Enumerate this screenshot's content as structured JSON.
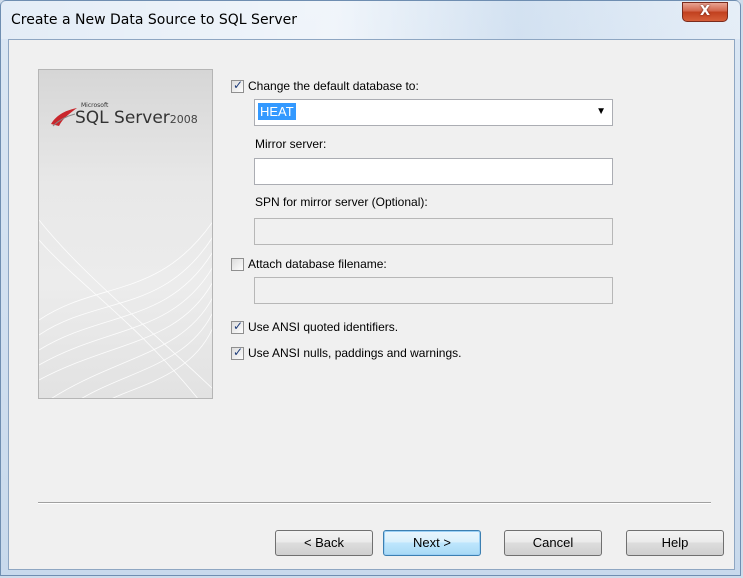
{
  "window": {
    "title": "Create a New Data Source to SQL Server",
    "close_label": "X"
  },
  "banner": {
    "logo_company": "Microsoft",
    "logo_product": "SQL Server",
    "logo_year": "2008"
  },
  "options": {
    "change_default_db": {
      "label": "Change the default database to:",
      "checked": true
    },
    "default_db_value": "HEAT",
    "mirror_server": {
      "label": "Mirror server:",
      "value": ""
    },
    "spn_mirror": {
      "label": "SPN for mirror server (Optional):",
      "value": ""
    },
    "attach_db": {
      "label": "Attach database filename:",
      "checked": false,
      "value": ""
    },
    "ansi_quoted": {
      "label": "Use ANSI quoted identifiers.",
      "checked": true
    },
    "ansi_nulls": {
      "label": "Use ANSI nulls, paddings and warnings.",
      "checked": true
    }
  },
  "buttons": {
    "back": "< Back",
    "next": "Next >",
    "cancel": "Cancel",
    "help": "Help"
  },
  "colors": {
    "selection": "#3399ff",
    "close_button": "#c1401f",
    "dialog_bg": "#f0f0f0"
  }
}
